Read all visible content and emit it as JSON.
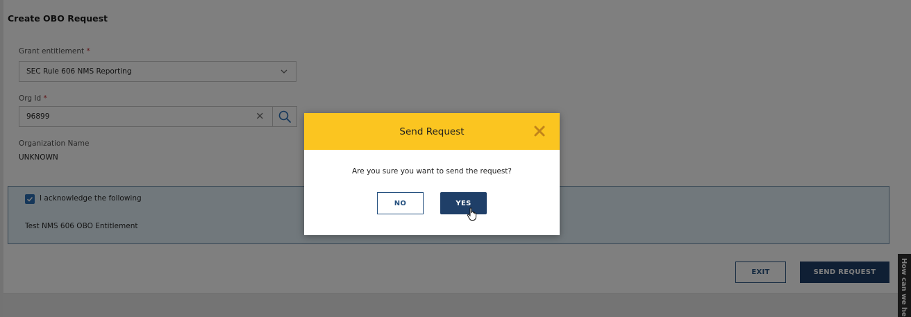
{
  "page": {
    "title": "Create OBO Request"
  },
  "form": {
    "grant_entitlement": {
      "label": "Grant entitlement",
      "required_mark": "*",
      "value": "SEC Rule 606 NMS Reporting"
    },
    "org_id": {
      "label": "Org Id",
      "required_mark": "*",
      "value": "96899"
    },
    "organization_name": {
      "label": "Organization Name",
      "value": "UNKNOWN"
    }
  },
  "acknowledge": {
    "checked": true,
    "label": "I acknowledge the following",
    "text": "Test NMS 606 OBO Entitlement"
  },
  "actions": {
    "exit_label": "EXIT",
    "send_label": "SEND REQUEST"
  },
  "help_tab": {
    "label": "How can we he"
  },
  "modal": {
    "title": "Send Request",
    "message": "Are you sure you want to send the request?",
    "no_label": "NO",
    "yes_label": "YES"
  },
  "icons": {
    "dropdown": "chevron-down-icon",
    "clear": "close-icon",
    "search": "search-icon",
    "checkbox": "checkmark-icon",
    "modal_close": "close-icon",
    "cursor": "hand-pointer-icon"
  },
  "colors": {
    "primary": "#1f3f68",
    "modal_header": "#fbc520",
    "panel_background": "#e2f0f8",
    "panel_border": "#6a8ba7",
    "checkbox": "#2b6fb4",
    "required": "#c0282d",
    "close_icon": "#c1841a"
  }
}
